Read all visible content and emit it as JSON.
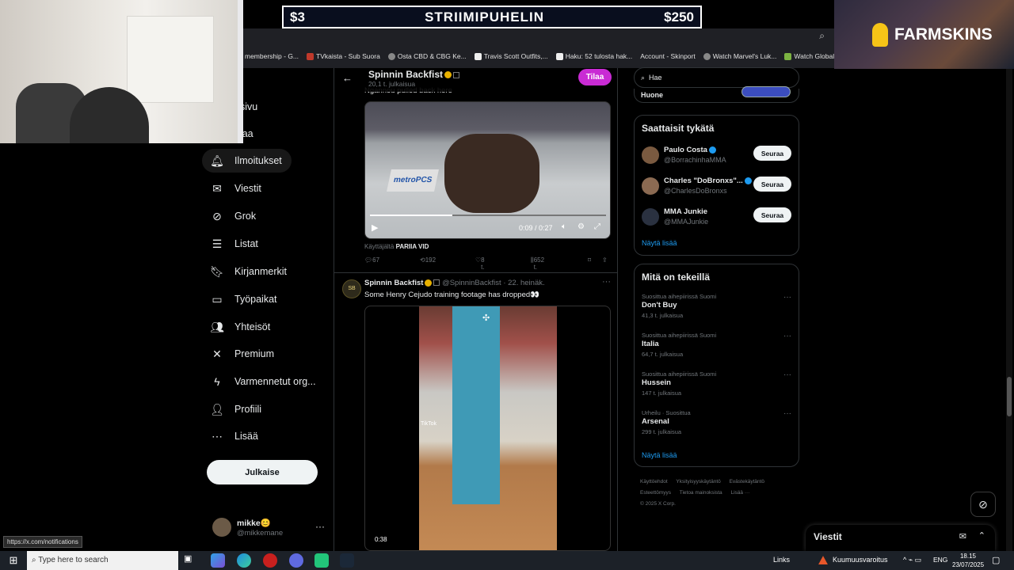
{
  "promo": {
    "left": "$3",
    "title": "STRIIMIPUHELIN",
    "right": "$250"
  },
  "overlay_brand": "FARMSKINS",
  "bookmarks": [
    "membership - G...",
    "TVkaista - Sub Suora",
    "Osta CBD & CBG Ke...",
    "Travis Scott Outfits,...",
    "Haku: 52 tulosta hak...",
    "Account - Skinport",
    "Watch Marvel's Luk...",
    "Watch Global & Loc..."
  ],
  "nav": {
    "items": [
      {
        "label": "usivu",
        "icon": "home-icon"
      },
      {
        "label": "elaa",
        "icon": "explore-icon"
      },
      {
        "label": "Ilmoitukset",
        "icon": "bell-icon"
      },
      {
        "label": "Viestit",
        "icon": "mail-icon"
      },
      {
        "label": "Grok",
        "icon": "grok-icon"
      },
      {
        "label": "Listat",
        "icon": "list-icon"
      },
      {
        "label": "Kirjanmerkit",
        "icon": "bookmark-icon"
      },
      {
        "label": "Työpaikat",
        "icon": "briefcase-icon"
      },
      {
        "label": "Yhteisöt",
        "icon": "people-icon"
      },
      {
        "label": "Premium",
        "icon": "x-logo-icon"
      },
      {
        "label": "Varmennetut org...",
        "icon": "lightning-icon"
      },
      {
        "label": "Profiili",
        "icon": "person-icon"
      },
      {
        "label": "Lisää",
        "icon": "more-circle-icon"
      }
    ],
    "post_label": "Julkaise"
  },
  "profile": {
    "name": "mikke😊",
    "handle": "@mikkemane"
  },
  "url_tooltip": "https://x.com/notifications",
  "header": {
    "title": "Spinnin Backfist",
    "subtitle": "20,1 t. julkaisua",
    "subscribe": "Tilaa"
  },
  "tweet1": {
    "text": "Ngannou pulled back here",
    "video": {
      "time": "0:09 / 0:27",
      "progress": 0.35,
      "logo": "metroPCS"
    },
    "attribution_prefix": "Käyttäjältä",
    "attribution_user": "PARIIA VID",
    "actions": {
      "replies": "67",
      "reposts": "192",
      "likes": "8 t.",
      "views": "652 t."
    }
  },
  "tweet2": {
    "avatar_text": "SB",
    "name": "Spinnin Backfist",
    "handle": "@SpinninBackfist",
    "date": "22. heinäk.",
    "text": "Some Henry Cejudo training footage has dropped👀",
    "duration": "0:38",
    "tiktok": "TikTok"
  },
  "search": {
    "value": "Hae"
  },
  "huone": {
    "label": "Huone"
  },
  "suggestions": {
    "title": "Saattaisit tykätä",
    "people": [
      {
        "name": "Paulo Costa",
        "handle": "@BorrachinhaMMA",
        "button": "Seuraa"
      },
      {
        "name": "Charles \"DoBronxs\"...",
        "handle": "@CharlesDoBronxs",
        "button": "Seuraa"
      },
      {
        "name": "MMA Junkie",
        "handle": "@MMAJunkie",
        "button": "Seuraa"
      }
    ],
    "show_more": "Näytä lisää"
  },
  "trends": {
    "title": "Mitä on tekeillä",
    "items": [
      {
        "context": "Suosittua aihepiirissä Suomi",
        "name": "Don't Buy",
        "posts": "41,3 t. julkaisua"
      },
      {
        "context": "Suosittua aihepiirissä Suomi",
        "name": "Italia",
        "posts": "64,7 t. julkaisua"
      },
      {
        "context": "Suosittua aihepiirissä Suomi",
        "name": "Hussein",
        "posts": "147 t. julkaisua"
      },
      {
        "context": "Urheilu · Suosittua",
        "name": "Arsenal",
        "posts": "299 t. julkaisua"
      }
    ],
    "show_more": "Näytä lisää"
  },
  "footer": {
    "links": [
      "Käyttöehdot",
      "Yksityisyyskäytäntö",
      "Evästekäytäntö",
      "Esteettömyys",
      "Tietoa mainoksista",
      "Lisää ···"
    ],
    "copyright": "© 2025 X Corp."
  },
  "dock": {
    "title": "Viestit"
  },
  "taskbar": {
    "search_placeholder": "Type here to search",
    "links": "Links",
    "weather": "Kuumuusvaroitus",
    "lang": "ENG",
    "time": "18.15",
    "date": "23/07/2025"
  },
  "colors": {
    "accent": "#1d9bf0",
    "subscribe": "#c92bd4",
    "background": "#000000"
  }
}
